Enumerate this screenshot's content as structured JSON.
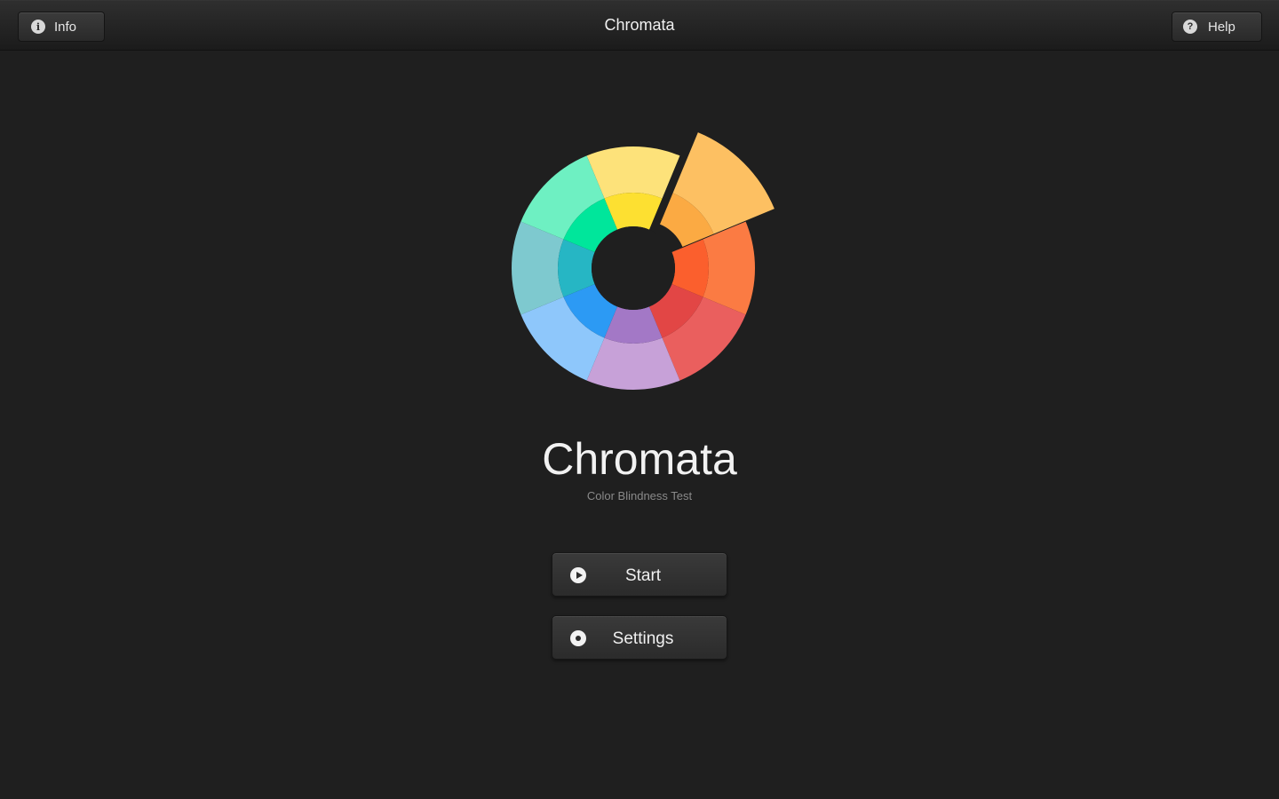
{
  "window": {
    "title": "Chromata"
  },
  "toolbar": {
    "info_label": "Info",
    "info_icon": "info-icon",
    "help_label": "Help",
    "help_icon": "question-icon"
  },
  "logo": {
    "title": "Chromata",
    "subtitle": "Color Blindness Test",
    "colors": {
      "outer": [
        "#fde27a",
        "#fdb861",
        "#fb7b43",
        "#ea5f5e",
        "#c7a1d8",
        "#8ec7fb",
        "#7ec9cf",
        "#6ef0c2"
      ],
      "inner": [
        "#fde031",
        "#fbaa43",
        "#fb5f2d",
        "#e24645",
        "#a378c6",
        "#2c9af4",
        "#26b6c4",
        "#00e69b"
      ],
      "highlight": "#fdc062"
    }
  },
  "menu": {
    "start_label": "Start",
    "start_icon": "play-icon",
    "settings_label": "Settings",
    "settings_icon": "gear-icon"
  }
}
